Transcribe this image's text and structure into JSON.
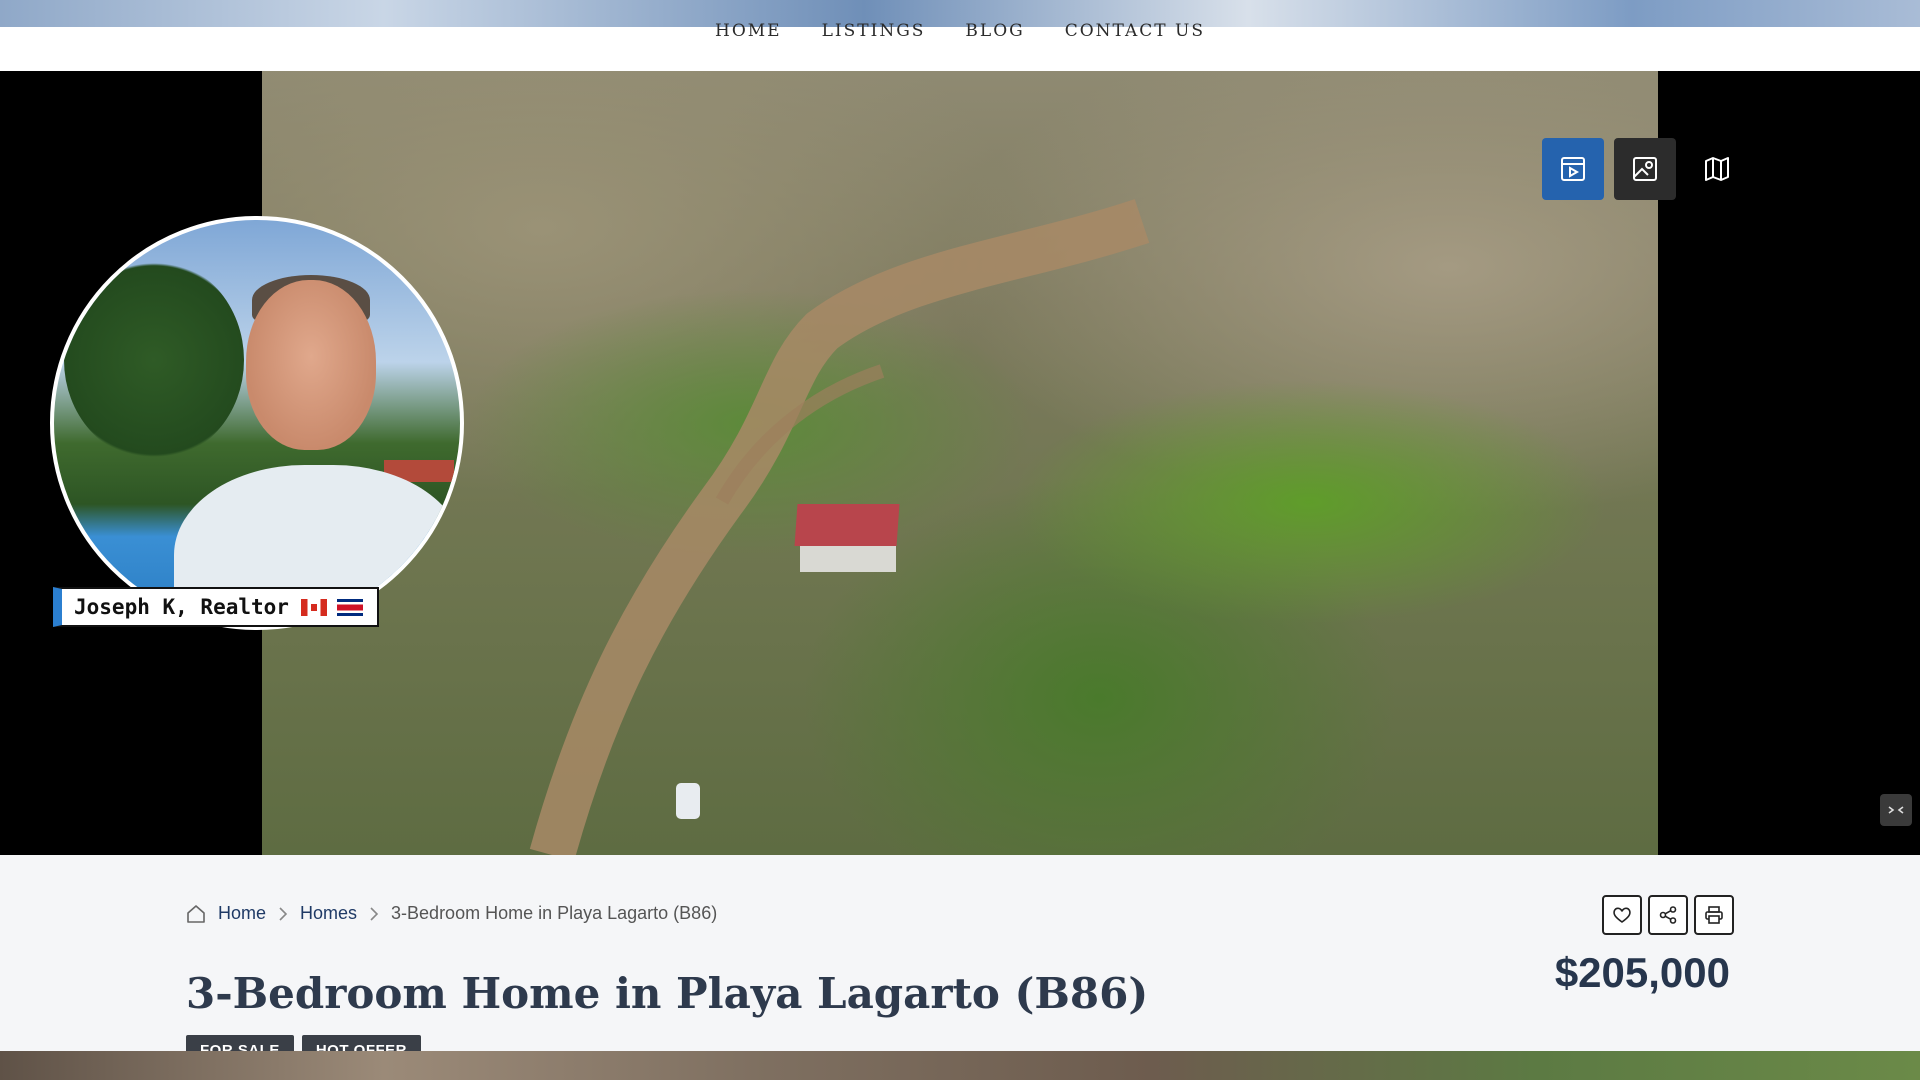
{
  "nav": {
    "items": [
      {
        "label": "HOME"
      },
      {
        "label": "LISTINGS"
      },
      {
        "label": "BLOG"
      },
      {
        "label": "CONTACT US"
      }
    ]
  },
  "hero": {
    "view_buttons": [
      {
        "icon": "video-icon",
        "state": "active"
      },
      {
        "icon": "photo-gallery-icon",
        "state": "inactive"
      },
      {
        "icon": "map-icon",
        "state": "inactive"
      }
    ]
  },
  "presenter": {
    "name_tag": "Joseph K, Realtor",
    "flags": [
      "canada-flag-icon",
      "costa-rica-flag-icon"
    ]
  },
  "breadcrumb": {
    "home": "Home",
    "category": "Homes",
    "current": "3-Bedroom Home in Playa Lagarto (B86)"
  },
  "actions": {
    "icons": [
      "heart-icon",
      "share-icon",
      "print-icon"
    ]
  },
  "listing": {
    "title": "3-Bedroom Home in Playa Lagarto (B86)",
    "price": "$205,000",
    "badges": [
      "FOR SALE",
      "HOT OFFER"
    ]
  },
  "colors": {
    "accent_blue": "#2563ae",
    "name_tag_bar": "#2b7fd0",
    "title_text": "#2e3a4d"
  }
}
